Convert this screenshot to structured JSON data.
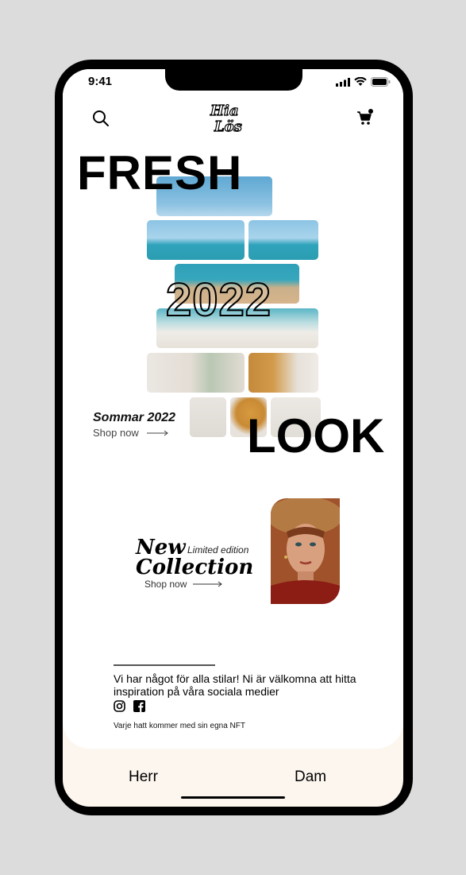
{
  "status_bar": {
    "time": "9:41"
  },
  "header": {
    "logo_icon": "hia-los-logo",
    "search_icon": "search-icon",
    "cart_icon": "cart-icon"
  },
  "hero": {
    "headline_top": "FRESH",
    "headline_mid": "2022",
    "headline_bottom": "LOOK",
    "collection_title": "Sommar 2022",
    "shop_label": "Shop now"
  },
  "promo": {
    "title_line1": "New",
    "title_line2": "Collection",
    "limited": "Limited edition",
    "shop_label": "Shop now"
  },
  "footer": {
    "text": "Vi har något för alla stilar! Ni är välkomna att hitta inspiration på våra sociala medier",
    "social": [
      "instagram-icon",
      "facebook-icon"
    ],
    "nft_note": "Varje hatt kommer med sin egna NFT"
  },
  "tab_bar": {
    "herr": "Herr",
    "dam": "Dam"
  }
}
